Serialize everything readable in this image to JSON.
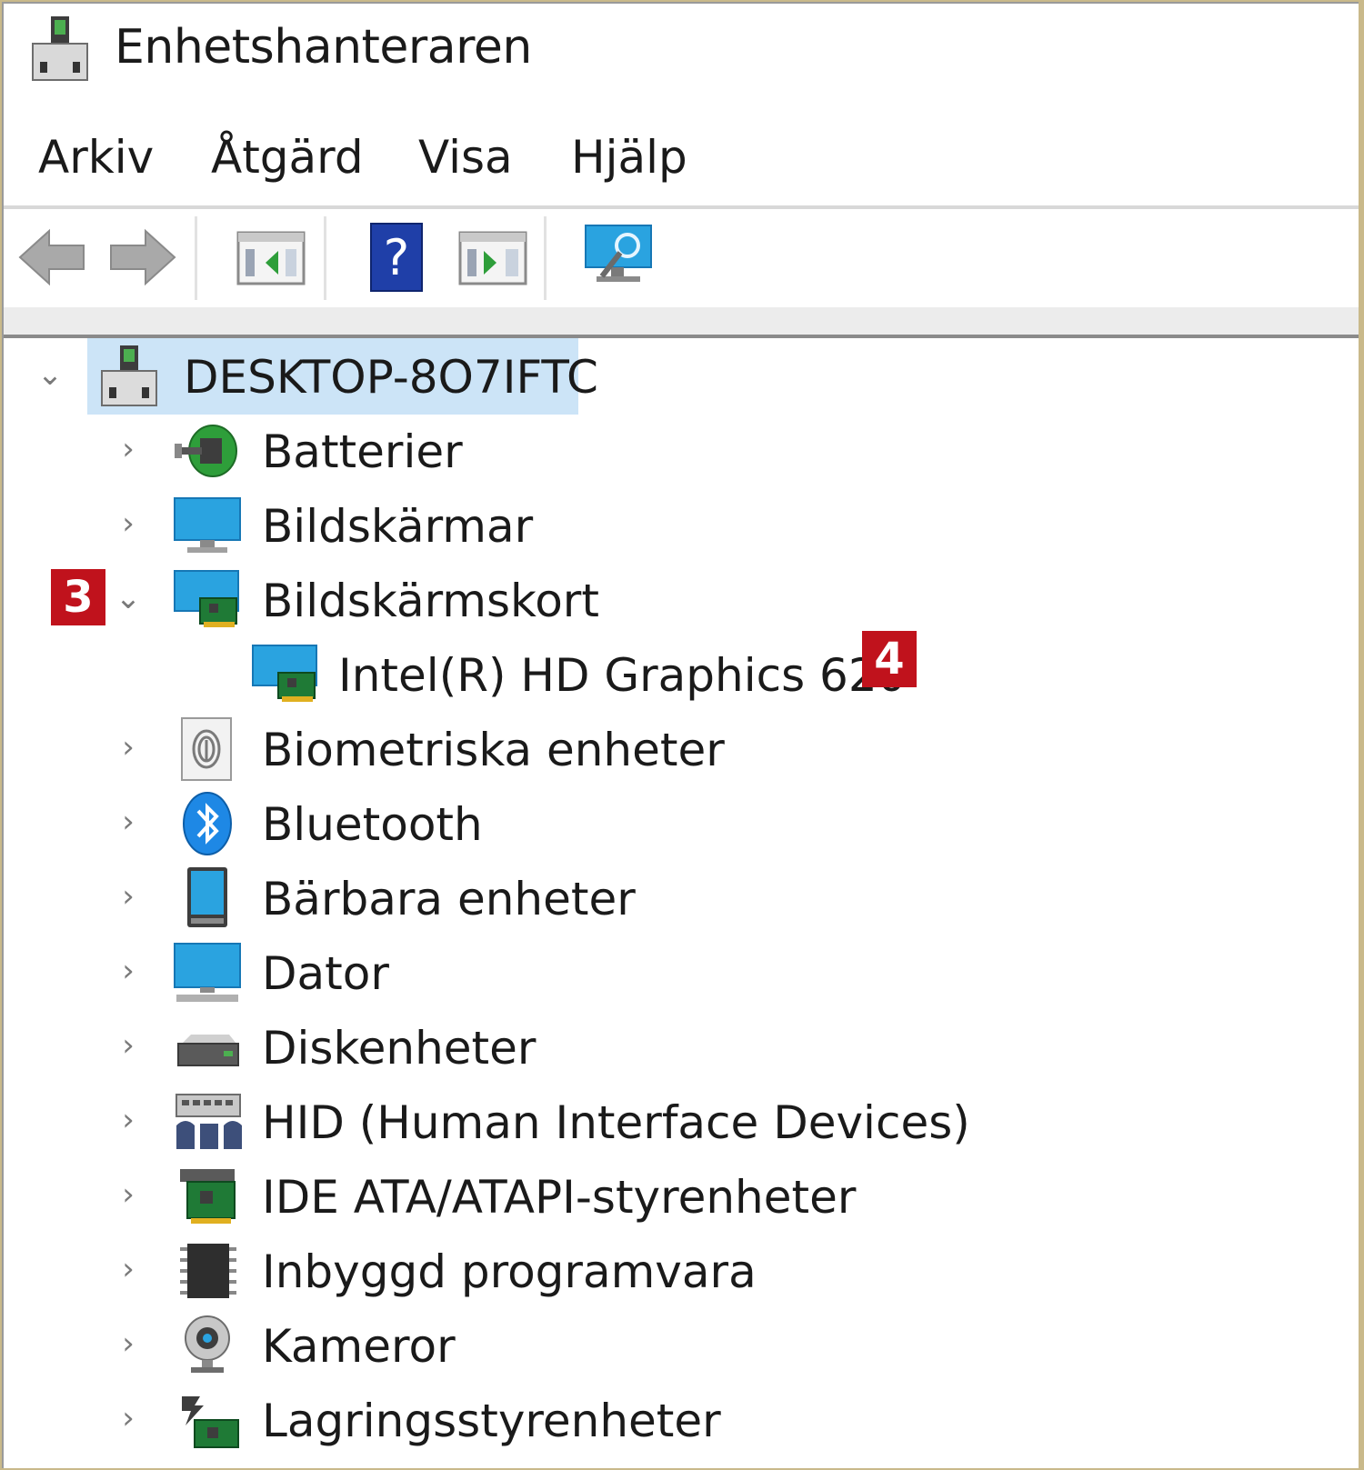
{
  "window": {
    "title": "Enhetshanteraren"
  },
  "menu": {
    "items": [
      "Arkiv",
      "Åtgärd",
      "Visa",
      "Hjälp"
    ]
  },
  "tree": {
    "root": "DESKTOP-8O7IFTC",
    "categories": [
      "Batterier",
      "Bildskärmar",
      "Bildskärmskort",
      "Intel(R) HD Graphics 620",
      "Biometriska enheter",
      "Bluetooth",
      "Bärbara enheter",
      "Dator",
      "Diskenheter",
      "HID (Human Interface Devices)",
      "IDE ATA/ATAPI-styrenheter",
      "Inbyggd programvara",
      "Kameror",
      "Lagringsstyrenheter"
    ]
  },
  "badges": {
    "step3": "3",
    "step4": "4"
  },
  "colors": {
    "selection": "#cce4f7",
    "badge": "#c0121c"
  }
}
